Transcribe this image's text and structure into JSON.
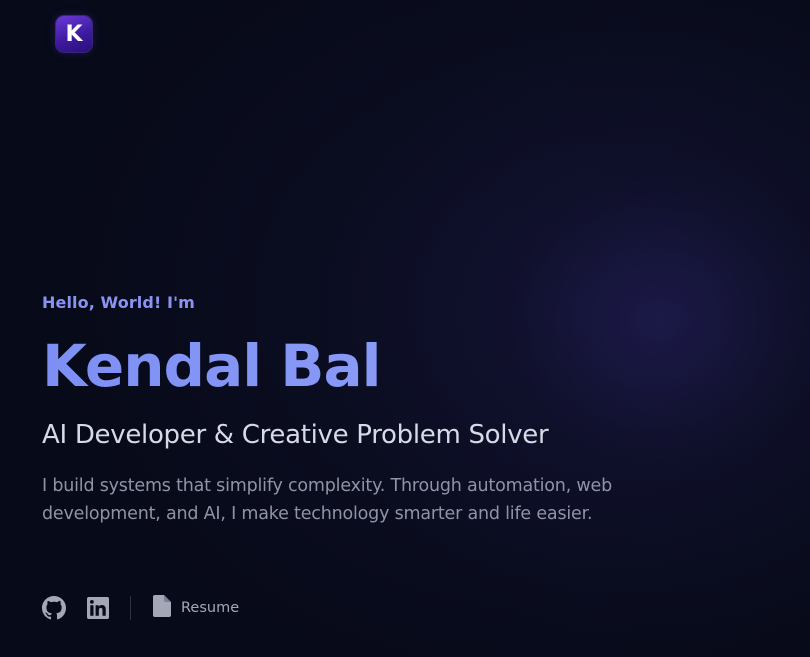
{
  "logo": {
    "letter": "K",
    "icon": "k-logo-icon"
  },
  "hero": {
    "greeting": "Hello, World! I'm",
    "name": "Kendal Bal",
    "tagline": "AI Developer & Creative Problem Solver",
    "bio": "I build systems that simplify complexity. Through automation, web development, and AI, I make technology smarter and life easier."
  },
  "links": {
    "github_icon": "github-icon",
    "linkedin_icon": "linkedin-icon",
    "resume_icon": "document-icon",
    "resume_label": "Resume"
  },
  "colors": {
    "background": "#070a18",
    "accent": "#8b93f2",
    "name_gradient_start": "#7d8ff4",
    "name_gradient_end": "#8fa2f7",
    "tagline": "#d6d9e6",
    "body_text": "#8e94a6",
    "icon": "#a3a8b8",
    "logo_gradient_start": "#6a3bd6",
    "logo_gradient_end": "#2a0f78"
  }
}
